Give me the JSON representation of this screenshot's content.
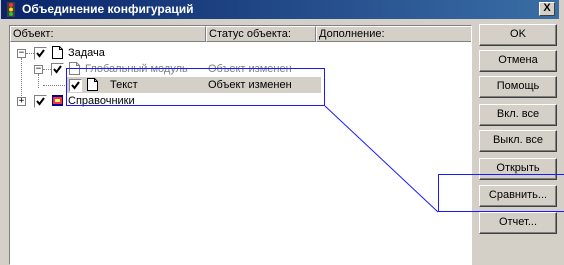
{
  "window": {
    "title": "Объединение конфигураций",
    "close_label": "X"
  },
  "columns": {
    "object": "Объект:",
    "status": "Статус объекта:",
    "extra": "Дополнение:"
  },
  "tree": [
    {
      "label": "Задача",
      "status": "",
      "checked": true,
      "expander": "−"
    },
    {
      "label": "Глобальный модуль",
      "status": "Объект изменен",
      "checked": true,
      "expander": "−"
    },
    {
      "label": "Текст",
      "status": "Объект изменен",
      "checked": true,
      "selected": true
    },
    {
      "label": "Справочники",
      "status": "",
      "checked": true,
      "expander": "+"
    }
  ],
  "buttons": {
    "ok": "OK",
    "cancel": "Отмена",
    "help": "Помощь",
    "select_all": "Вкл. все",
    "deselect_all": "Выкл. все",
    "open": "Открыть",
    "compare": "Сравнить...",
    "report": "Отчет..."
  },
  "colors": {
    "titlebar_start": "#0a246a",
    "titlebar_end": "#3a6ea5",
    "annotation": "#1a1aff",
    "selected_row": "#d4d0c8"
  }
}
